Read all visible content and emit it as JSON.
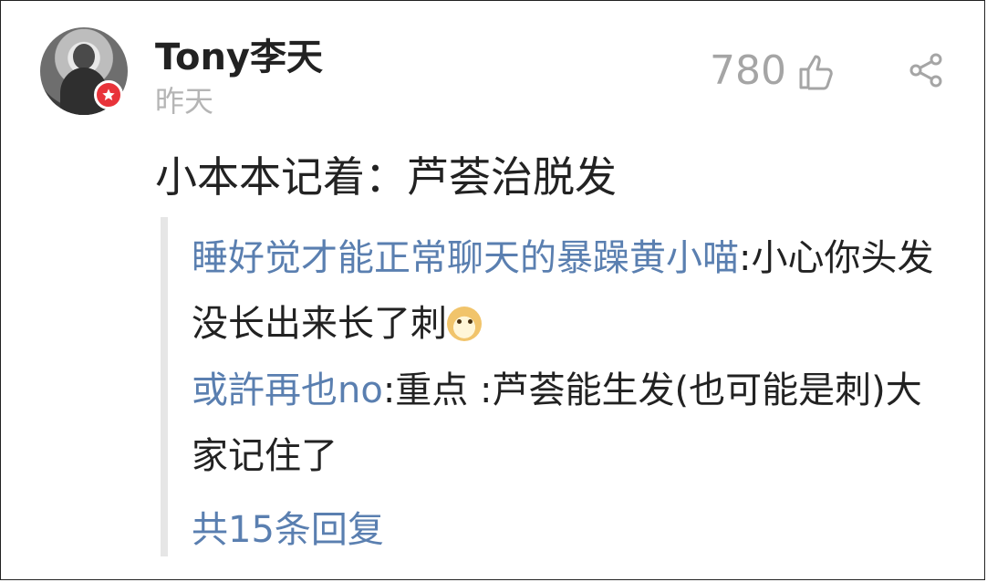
{
  "post": {
    "username": "Tony李天",
    "time": "昨天",
    "likes": "780",
    "comment": "小本本记着：芦荟治脱发"
  },
  "replies": [
    {
      "author": "睡好觉才能正常聊天的暴躁黄小喵",
      "text": ":小心你头发没长出来长了刺",
      "emoji": "doge-emoji"
    },
    {
      "author": "或許再也no",
      "text": ":重点 :芦荟能生发(也可能是刺)大家记住了"
    }
  ],
  "more_replies": "共15条回复",
  "icons": {
    "badge": "star-badge-icon",
    "like": "thumbs-up-icon",
    "share": "share-icon"
  },
  "colors": {
    "link": "#5a7fb0",
    "muted": "#a5a5a5",
    "badge": "#e8333a"
  }
}
